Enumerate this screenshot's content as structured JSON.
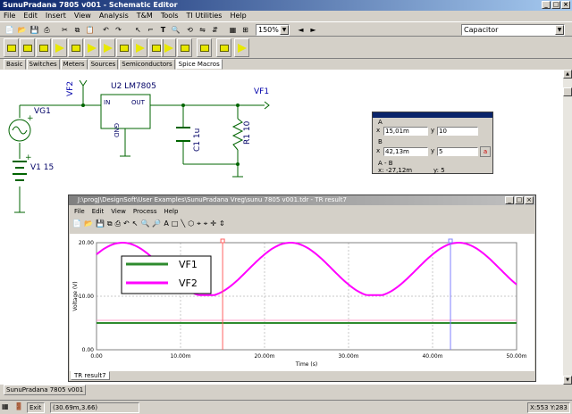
{
  "window": {
    "title": "SunuPradana 7805 v001 - Schematic Editor"
  },
  "menu": [
    "File",
    "Edit",
    "Insert",
    "View",
    "Analysis",
    "T&M",
    "Tools",
    "TI Utilities",
    "Help"
  ],
  "toolbar": {
    "zoom": "150%",
    "component_select": "Capacitor"
  },
  "tabs": [
    "Basic",
    "Switches",
    "Meters",
    "Sources",
    "Semiconductors",
    "Spice Macros"
  ],
  "active_tab": "Spice Macros",
  "schematic": {
    "vf2": "VF2",
    "u2": "U2 LM7805",
    "in": "IN",
    "out": "OUT",
    "gnd": "GND",
    "vf1": "VF1",
    "vg1": "VG1",
    "v1": "V1 15",
    "c1": "C1 1u",
    "r1": "R1 10",
    "plus1": "+",
    "plus2": "+"
  },
  "cursor_panel": {
    "a_label": "A",
    "b_label": "B",
    "x_label": "x",
    "y_label": "y",
    "a_x": "15,01m",
    "a_y": "10",
    "b_x": "42,13m",
    "b_y": "5",
    "ab_label": "A - B",
    "ab_x": "x: -27,12m",
    "ab_y": "y: 5",
    "b_btn": "a"
  },
  "tr_window": {
    "title": "J:\\progJ\\DesignSoft\\User Examples\\SunuPradana Vreg\\sunu 7805 v001.tdr - TR result7",
    "menu": [
      "File",
      "Edit",
      "View",
      "Process",
      "Help"
    ],
    "tab": "TR result7"
  },
  "chart_data": {
    "type": "line",
    "xlabel": "Time (s)",
    "ylabel": "Voltage (V)",
    "xlim": [
      0,
      30
    ],
    "ylim": [
      0,
      20
    ],
    "x_ticks": [
      "0.00",
      "10.00m",
      "20.00m",
      "30.00m",
      "40.00m",
      "50.00m"
    ],
    "y_ticks": [
      "20.00",
      "10.00",
      "0.00"
    ],
    "series": [
      {
        "name": "VF1",
        "color": "#2e8b2e",
        "values": [
          {
            "x": 0,
            "y": 5
          },
          {
            "x": 30,
            "y": 5
          }
        ]
      },
      {
        "name": "VF2",
        "color": "#ff00ff",
        "description_points": [
          {
            "x": 0,
            "y": 15
          },
          {
            "x": 5,
            "y": 20
          },
          {
            "x": 15,
            "y": 10
          },
          {
            "x": 25,
            "y": 20
          },
          {
            "x": 35,
            "y": 10
          },
          {
            "x": 45,
            "y": 20
          },
          {
            "x": 50,
            "y": 16
          }
        ]
      }
    ],
    "cursor_a_x": 15.01,
    "cursor_b_x": 42.13,
    "legend": "top-left"
  },
  "status": {
    "coords": "(30.69m,3.66)",
    "xy": "X:553 Y:283",
    "exit": "Exit",
    "bottom_tab": "SunuPradana 7805 v001"
  }
}
